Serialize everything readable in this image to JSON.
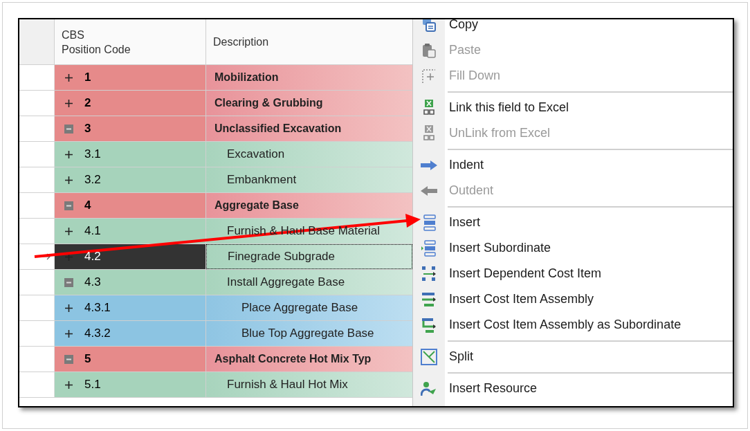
{
  "table": {
    "columns": [
      "CBS\nPosition Code",
      "Description"
    ],
    "rows": [
      {
        "code": "1",
        "description": "Mobilization",
        "expanded": false,
        "selected": false
      },
      {
        "code": "2",
        "description": "Clearing & Grubbing",
        "expanded": false,
        "selected": false
      },
      {
        "code": "3",
        "description": "Unclassified Excavation",
        "expanded": true,
        "selected": false,
        "children": [
          {
            "code": "3.1",
            "description": "Excavation",
            "expanded": false,
            "selected": false
          },
          {
            "code": "3.2",
            "description": "Embankment",
            "expanded": false,
            "selected": false
          }
        ]
      },
      {
        "code": "4",
        "description": "Aggregate Base",
        "expanded": true,
        "selected": false,
        "children": [
          {
            "code": "4.1",
            "description": "Furnish & Haul Base Material",
            "expanded": false,
            "selected": false
          },
          {
            "code": "4.2",
            "description": "Finegrade Subgrade",
            "expanded": false,
            "selected": true
          },
          {
            "code": "4.3",
            "description": "Install Aggregate Base",
            "expanded": true,
            "selected": false,
            "children": [
              {
                "code": "4.3.1",
                "description": "Place Aggregate Base",
                "expanded": false,
                "selected": false
              },
              {
                "code": "4.3.2",
                "description": "Blue Top Aggregate Base",
                "expanded": false,
                "selected": false
              }
            ]
          }
        ]
      },
      {
        "code": "5",
        "description": "Asphalt Concrete Hot Mix Typ",
        "expanded": true,
        "selected": false,
        "children": [
          {
            "code": "5.1",
            "description": "Furnish & Haul Hot Mix",
            "expanded": false,
            "selected": false
          }
        ]
      }
    ]
  },
  "context_menu": {
    "items": [
      {
        "kind": "item",
        "label": "Copy",
        "disabled": false
      },
      {
        "kind": "item",
        "label": "Paste",
        "disabled": true
      },
      {
        "kind": "item",
        "label": "Fill Down",
        "disabled": true
      },
      {
        "kind": "separator"
      },
      {
        "kind": "item",
        "label": "Link this field to Excel",
        "disabled": false
      },
      {
        "kind": "item",
        "label": "UnLink from Excel",
        "disabled": true
      },
      {
        "kind": "separator"
      },
      {
        "kind": "item",
        "label": "Indent",
        "disabled": false
      },
      {
        "kind": "item",
        "label": "Outdent",
        "disabled": true
      },
      {
        "kind": "separator"
      },
      {
        "kind": "item",
        "label": "Insert",
        "disabled": false
      },
      {
        "kind": "item",
        "label": "Insert Subordinate",
        "disabled": false
      },
      {
        "kind": "item",
        "label": "Insert Dependent Cost Item",
        "disabled": false
      },
      {
        "kind": "item",
        "label": "Insert Cost Item Assembly",
        "disabled": false
      },
      {
        "kind": "item",
        "label": "Insert Cost Item Assembly as Subordinate",
        "disabled": false
      },
      {
        "kind": "separator"
      },
      {
        "kind": "item",
        "label": "Split",
        "disabled": false
      },
      {
        "kind": "separator"
      },
      {
        "kind": "item",
        "label": "Insert Resource",
        "disabled": false
      }
    ]
  }
}
